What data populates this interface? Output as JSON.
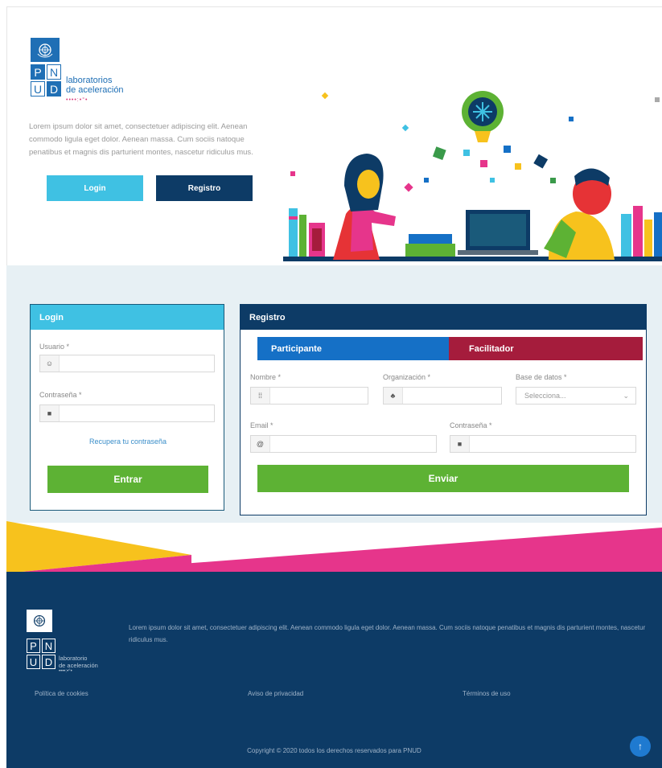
{
  "brand": {
    "emblem_icon": "un-emblem-icon",
    "grid_letters": [
      "P",
      "N",
      "U",
      "D"
    ],
    "name_line1": "laboratorios",
    "name_line2": "de aceleración",
    "dots": "••••:•°•",
    "blue": "#1f6fb5",
    "pink": "#d93a7b"
  },
  "hero": {
    "description": "Lorem ipsum dolor sit amet, consectetuer adipiscing elit. Aenean commodo ligula eget dolor. Aenean massa. Cum sociis natoque penatibus et magnis dis parturient montes, nascetur ridiculus mus.",
    "login_label": "Login",
    "register_label": "Registro",
    "login_color": "#3fc1e3",
    "register_color": "#0d3b66"
  },
  "login_form": {
    "title": "Login",
    "user_label": "Usuario *",
    "user_icon": "user-icon",
    "password_label": "Contraseña *",
    "password_icon": "lock-icon",
    "forgot_label": "Recupera tu contraseña",
    "submit_label": "Entrar",
    "header_color": "#3fc1e3",
    "submit_color": "#5db234"
  },
  "register_form": {
    "title": "Registro",
    "tabs": [
      {
        "label": "Participante",
        "color": "#1570c6"
      },
      {
        "label": "Facilitador",
        "color": "#a51c3c"
      }
    ],
    "name_label": "Nombre *",
    "name_icon": "id-card-icon",
    "org_label": "Organización *",
    "org_icon": "org-chart-icon",
    "db_label": "Base de datos *",
    "db_placeholder": "Selecciona...",
    "email_label": "Email *",
    "email_icon": "at-icon",
    "password_label": "Contraseña *",
    "password_icon": "lock-icon",
    "submit_label": "Enviar",
    "header_color": "#0d3b66"
  },
  "footer": {
    "background": "#0d3b66",
    "name_line1": "laboratorio",
    "name_line2": "de aceleración",
    "text": "Lorem ipsum dolor sit amet, consectetuer adipiscing elit. Aenean commodo ligula eget dolor. Aenean massa. Cum sociis natoque penatibus et magnis dis parturient montes, nascetur ridiculus mus.",
    "links": [
      "Política de cookies",
      "Aviso de privacidad",
      "Términos de uso"
    ],
    "copyright": "Copyright © 2020 todos los derechos reservados para PNUD",
    "to_top_icon": "arrow-up-icon"
  },
  "bands": {
    "yellow": "#f7c21d",
    "pink": "#e6358b"
  }
}
